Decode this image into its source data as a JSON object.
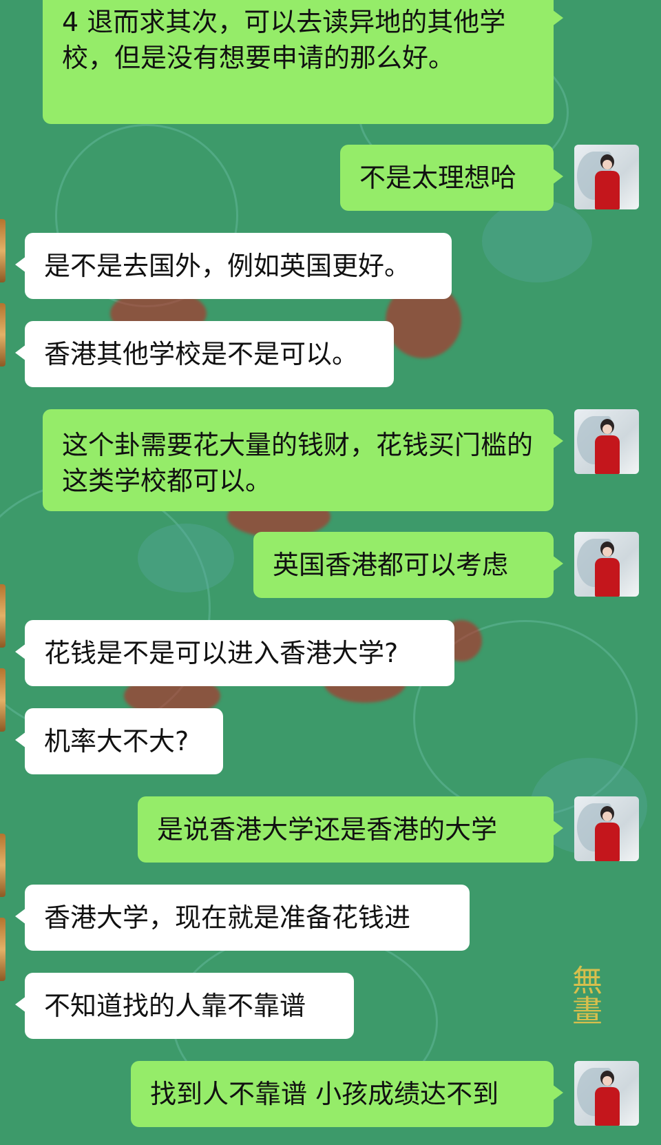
{
  "messages": [
    {
      "side": "right",
      "text": "4 退而求其次，可以去读异地的其他学校，但是没有想要申请的那么好。"
    },
    {
      "side": "right",
      "text": "不是太理想哈"
    },
    {
      "side": "left",
      "text": "是不是去国外，例如英国更好。"
    },
    {
      "side": "left",
      "text": "香港其他学校是不是可以。"
    },
    {
      "side": "right",
      "text": "这个卦需要花大量的钱财，花钱买门槛的这类学校都可以。"
    },
    {
      "side": "right",
      "text": "英国香港都可以考虑"
    },
    {
      "side": "left",
      "text": "花钱是不是可以进入香港大学?"
    },
    {
      "side": "left",
      "text": "机率大不大?"
    },
    {
      "side": "right",
      "text": "是说香港大学还是香港的大学"
    },
    {
      "side": "left",
      "text": "香港大学，现在就是准备花钱进"
    },
    {
      "side": "left",
      "text": "不知道找的人靠不靠谱"
    },
    {
      "side": "right",
      "text": "找到人不靠谱 小孩成绩达不到"
    }
  ],
  "background": {
    "watermark_text": "無畫",
    "colors": {
      "wallpaper": "#3d9a6a",
      "bubble_self": "#95ec69",
      "bubble_other": "#ffffff"
    }
  },
  "avatar_icon": "avatar-woman-red-dress"
}
